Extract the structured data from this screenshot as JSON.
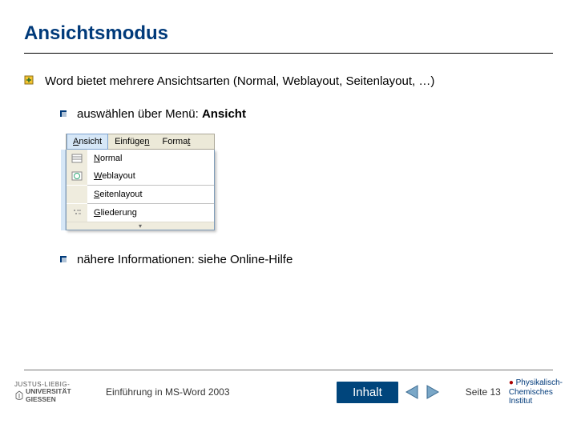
{
  "title": "Ansichtsmodus",
  "bullets": {
    "main": "Word bietet mehrere Ansichtsarten (Normal, Weblayout, Seitenlayout, …)",
    "sub1_pre": "auswählen über Menü: ",
    "sub1_bold": "Ansicht",
    "sub2": "nähere Informationen: siehe Online-Hilfe"
  },
  "menu": {
    "bar": {
      "ansicht": "Ansicht",
      "einfuegen": "Einfügen",
      "format": "Format"
    },
    "items": {
      "normal": "Normal",
      "weblayout": "Weblayout",
      "seitenlayout": "Seitenlayout",
      "gliederung": "Gliederung"
    }
  },
  "footer": {
    "uni_line1": "JUSTUS-LIEBIG-",
    "uni_line2": "UNIVERSITÄT",
    "uni_line3": "GIESSEN",
    "course": "Einführung in MS-Word 2003",
    "inhalt": "Inhalt",
    "page": "Seite 13",
    "inst_l1": "Physikalisch-",
    "inst_l2": "Chemisches",
    "inst_l3": "Institut"
  }
}
